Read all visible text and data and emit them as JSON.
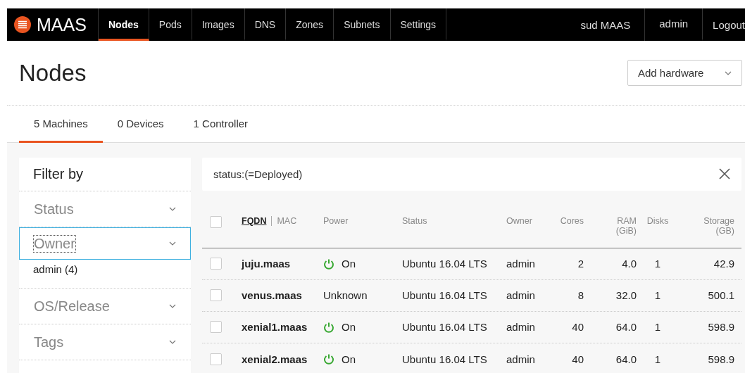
{
  "nav": {
    "brand": "MAAS",
    "items": [
      {
        "label": "Nodes",
        "selected": true
      },
      {
        "label": "Pods",
        "selected": false
      },
      {
        "label": "Images",
        "selected": false
      },
      {
        "label": "DNS",
        "selected": false
      },
      {
        "label": "Zones",
        "selected": false
      },
      {
        "label": "Subnets",
        "selected": false
      },
      {
        "label": "Settings",
        "selected": false
      }
    ],
    "region_name": "sud MAAS",
    "user": "admin",
    "logout": "Logout"
  },
  "page": {
    "title": "Nodes",
    "add_button": "Add hardware"
  },
  "tabs": [
    {
      "label": "5 Machines",
      "selected": true
    },
    {
      "label": "0 Devices",
      "selected": false
    },
    {
      "label": "1 Controller",
      "selected": false
    }
  ],
  "sidebar": {
    "title": "Filter by",
    "groups": [
      {
        "label": "Status",
        "focused": false
      },
      {
        "label": "Owner",
        "focused": true,
        "options": [
          {
            "label": "admin (4)"
          }
        ]
      },
      {
        "label": "OS/Release",
        "focused": false
      },
      {
        "label": "Tags",
        "focused": false
      }
    ]
  },
  "search": {
    "value": "status:(=Deployed)"
  },
  "table": {
    "select_all_checked": false,
    "sort_keys": [
      {
        "label": "FQDN",
        "selected": true
      },
      {
        "label": "MAC",
        "selected": false
      }
    ],
    "columns": [
      {
        "label": "Power"
      },
      {
        "label": "Status"
      },
      {
        "label": "Owner"
      },
      {
        "label": "Cores"
      },
      {
        "label": "RAM",
        "unit": "(GiB)"
      },
      {
        "label": "Disks"
      },
      {
        "label": "Storage",
        "unit": "(GB)"
      }
    ],
    "rows": [
      {
        "checked": false,
        "fqdn": "juju.maas",
        "power_on": true,
        "power": "On",
        "status": "Ubuntu 16.04 LTS",
        "owner": "admin",
        "cores": "2",
        "ram": "4.0",
        "disks": "1",
        "storage": "42.9"
      },
      {
        "checked": false,
        "fqdn": "venus.maas",
        "power_on": false,
        "power": "Unknown",
        "status": "Ubuntu 16.04 LTS",
        "owner": "admin",
        "cores": "8",
        "ram": "32.0",
        "disks": "1",
        "storage": "500.1"
      },
      {
        "checked": false,
        "fqdn": "xenial1.maas",
        "power_on": true,
        "power": "On",
        "status": "Ubuntu 16.04 LTS",
        "owner": "admin",
        "cores": "40",
        "ram": "64.0",
        "disks": "1",
        "storage": "598.9"
      },
      {
        "checked": false,
        "fqdn": "xenial2.maas",
        "power_on": true,
        "power": "On",
        "status": "Ubuntu 16.04 LTS",
        "owner": "admin",
        "cores": "40",
        "ram": "64.0",
        "disks": "1",
        "storage": "598.9"
      }
    ]
  }
}
